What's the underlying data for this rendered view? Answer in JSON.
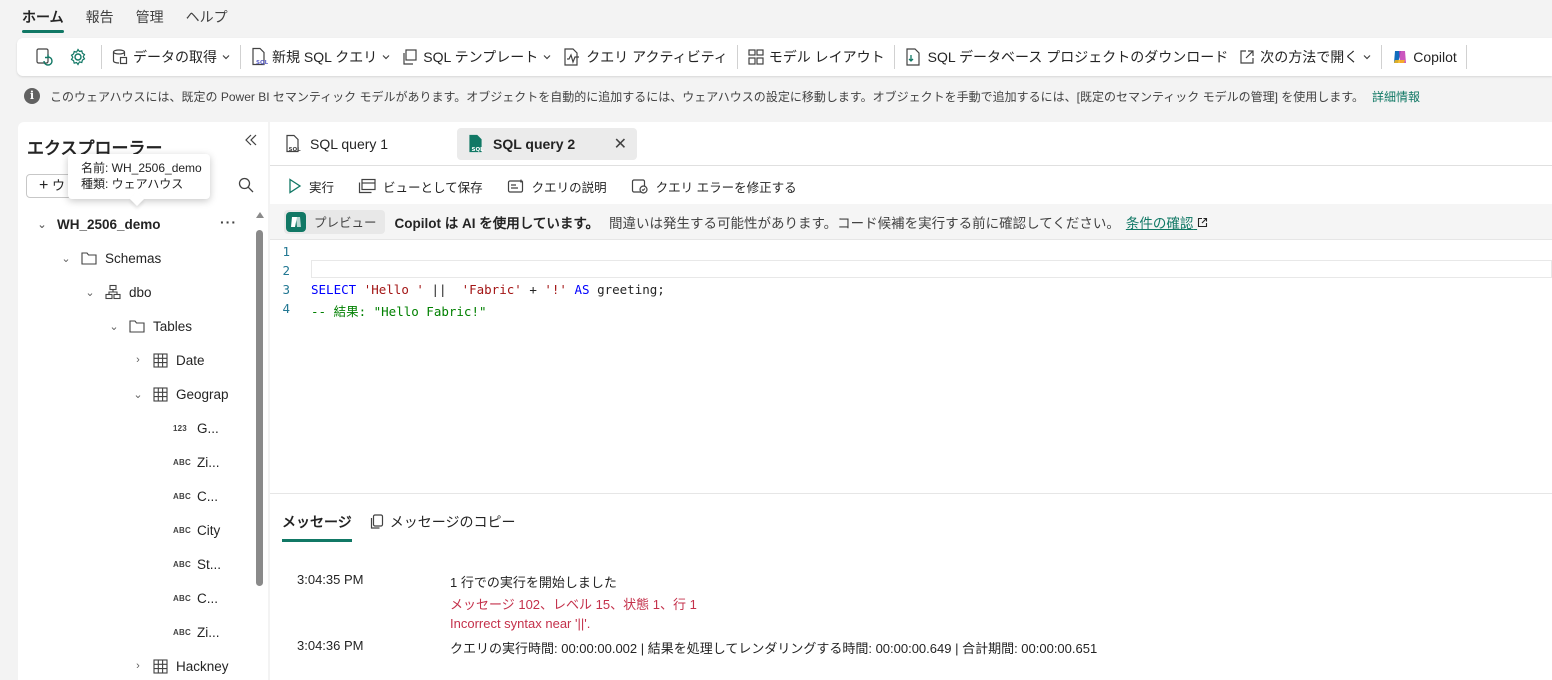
{
  "menu": {
    "tabs": [
      "ホーム",
      "報告",
      "管理",
      "ヘルプ"
    ],
    "active": 0
  },
  "ribbon": {
    "get_data": "データの取得",
    "new_sql_query": "新規 SQL クエリ",
    "sql_template": "SQL テンプレート",
    "query_activity": "クエリ アクティビティ",
    "model_layout": "モデル レイアウト",
    "download_project": "SQL データベース プロジェクトのダウンロード",
    "open_in": "次の方法で開く",
    "copilot": "Copilot"
  },
  "info": {
    "text": "このウェアハウスには、既定の Power BI セマンティック モデルがあります。オブジェクトを自動的に追加するには、ウェアハウスの設定に移動します。オブジェクトを手動で追加するには、[既定のセマンティック モデルの管理] を使用します。",
    "link": "詳細情報"
  },
  "explorer": {
    "title": "エクスプローラー",
    "new_label": "ウ",
    "tooltip_line1": "名前: WH_2506_demo",
    "tooltip_line2": "種類: ウェアハウス",
    "warehouse": "WH_2506_demo",
    "schemas": "Schemas",
    "dbo": "dbo",
    "tables": "Tables",
    "date": "Date",
    "geography": "Geograp",
    "columns": [
      {
        "type": "123",
        "name": "G..."
      },
      {
        "type": "ABC",
        "name": "Zi..."
      },
      {
        "type": "ABC",
        "name": "C..."
      },
      {
        "type": "ABC",
        "name": "City"
      },
      {
        "type": "ABC",
        "name": "St..."
      },
      {
        "type": "ABC",
        "name": "C..."
      },
      {
        "type": "ABC",
        "name": "Zi..."
      }
    ],
    "hackney": "Hackney"
  },
  "tabs": [
    {
      "label": "SQL query 1"
    },
    {
      "label": "SQL query 2"
    }
  ],
  "toolbar": {
    "run": "実行",
    "save_as_view": "ビューとして保存",
    "explain_query": "クエリの説明",
    "fix_errors": "クエリ エラーを修正する"
  },
  "copilot_bar": {
    "badge": "プレビュー",
    "strong": "Copilot は AI を使用しています。",
    "text": "間違いは発生する可能性があります。コード候補を実行する前に確認してください。",
    "link": "条件の確認"
  },
  "editor": {
    "line_numbers": [
      "1",
      "2",
      "3",
      "4"
    ],
    "kw_select": "SELECT",
    "str_hello": "'Hello '",
    "op_concat": "||",
    "str_fabric": "'Fabric'",
    "op_plus": "+",
    "str_bang": "'!'",
    "kw_as": "AS",
    "ident": "greeting;",
    "comment": "-- 結果: \"Hello Fabric!\""
  },
  "messages": {
    "tab_messages": "メッセージ",
    "tab_copy": "メッセージのコピー",
    "rows": [
      {
        "time": "3:04:35 PM",
        "text": "1 行での実行を開始しました"
      },
      {
        "time": "",
        "text": "メッセージ 102、レベル 15、状態 1、行 1"
      },
      {
        "time": "",
        "text": "Incorrect syntax near '||'."
      },
      {
        "time": "3:04:36 PM",
        "text": "クエリの実行時間: 00:00:00.002 | 結果を処理してレンダリングする時間: 00:00:00.649 | 合計期間: 00:00:00.651"
      }
    ]
  },
  "colors": {
    "accent": "#117865",
    "error": "#c4314b"
  }
}
